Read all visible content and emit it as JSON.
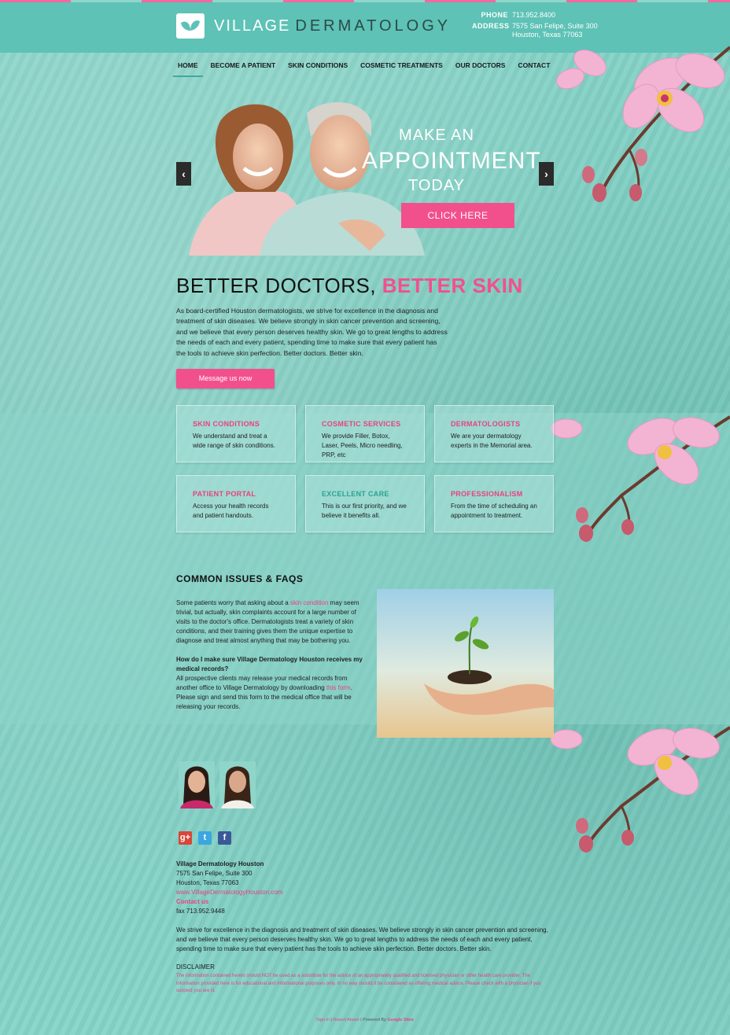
{
  "header": {
    "logo_word1": "VILLAGE",
    "logo_word2": "DERMATOLOGY",
    "phone_label": "PHONE",
    "phone": "713.952.8400",
    "address_label": "ADDRESS",
    "address_line1": "7575 San Felipe, Suite 300",
    "address_line2": "Houston, Texas 77063"
  },
  "nav": [
    "HOME",
    "BECOME A PATIENT",
    "SKIN CONDITIONS",
    "COSMETIC TREATMENTS",
    "OUR DOCTORS",
    "CONTACT"
  ],
  "hero": {
    "line1": "MAKE AN",
    "line2": "APPOINTMENT",
    "line3": "TODAY",
    "cta": "CLICK HERE",
    "prev": "‹",
    "next": "›"
  },
  "intro": {
    "heading_part1": "BETTER DOCTORS, ",
    "heading_part2": "BETTER SKIN",
    "text": "As board-certified Houston dermatologists, we strive for excellence in the diagnosis and treatment of skin diseases. We believe strongly in skin cancer prevention and screening, and we believe that every person deserves healthy skin. We go to great lengths to address the needs of each and every patient, spending time to make sure that every patient has the tools to achieve skin perfection. Better doctors. Better skin.",
    "button": "Message us now"
  },
  "cards": [
    {
      "title": "SKIN CONDITIONS",
      "text": "We understand and treat a wide range of skin conditions."
    },
    {
      "title": "COSMETIC SERVICES",
      "text": "We provide Filler, Botox, Laser, Peels, Micro needling, PRP, etc"
    },
    {
      "title": "DERMATOLOGISTS",
      "text": "We are your dermatology experts in the Memorial area."
    },
    {
      "title": "PATIENT PORTAL",
      "text": "Access your health records and patient handouts."
    },
    {
      "title": "EXCELLENT CARE",
      "text": "This is our first priority, and we believe it benefits all."
    },
    {
      "title": "PROFESSIONALISM",
      "text": "From the time of scheduling an appointment to treatment."
    }
  ],
  "faq": {
    "heading": "COMMON ISSUES & FAQS",
    "p1_before": "Some patients worry that asking about a ",
    "p1_link": "skin condition",
    "p1_after": " may seem trivial, but actually, skin complaints account for a large number of visits to the doctor's office. Dermatologists treat a variety of skin conditions, and their training gives them the unique expertise to diagnose and treat almost anything that may be bothering you.",
    "question": "How do I make sure Village Dermatology Houston receives my medical records?",
    "p2_before": "All prospective clients may release your medical records from another office to Village Dermatology by downloading ",
    "p2_link": "this form",
    "p2_after": ". Please sign and send this form to the medical office that will be releasing your records."
  },
  "social": {
    "google": "g+",
    "twitter": "t",
    "facebook": "f"
  },
  "footer": {
    "name": "Village Dermatology Houston",
    "address1": "7575 San Felipe, Suite 300",
    "address2": "Houston, Texas 77063",
    "website": "www.VillageDermatologyHouston.com",
    "contact": "Contact us",
    "fax": "fax 713.952.9448",
    "about": "We strive for excellence in the diagnosis and treatment of skin diseases. We believe strongly in skin cancer prevention and screening, and we believe that every person deserves healthy skin. We go to great lengths to address the needs of each and every patient, spending time to make sure that every patient has the tools to achieve skin perfection. Better doctors. Better skin.",
    "disclaimer_title": "DISCLAIMER",
    "disclaimer": "The information contained herein should NOT be used as a substitute for the advice of an appropriately qualified and licensed physician or other health care provider. The information provided here is for educational and informational purposes only. In no way should it be considered as offering medical advice. Please check with a physician if you suspect you are ill.",
    "bottom_link1": "Sign in",
    "bottom_link2": "Report Abuse",
    "bottom_sep": " | ",
    "bottom_text": "Powered By ",
    "bottom_link3": "Google Sites"
  },
  "colors": {
    "accent": "#f2508d",
    "header": "#5ec2b6",
    "teal_title": "#2aa393"
  }
}
